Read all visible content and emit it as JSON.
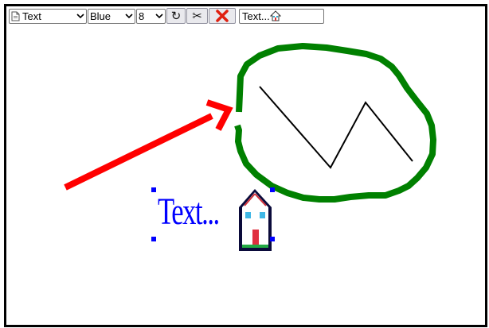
{
  "toolbar": {
    "tool_select": {
      "value": "Text",
      "icon": "document-icon"
    },
    "color_select": {
      "value": "Blue"
    },
    "size_select": {
      "value": "8"
    },
    "undo_glyph": "↻",
    "cut_glyph": "✂",
    "delete_glyph": "✖",
    "text_input_value": "Text...",
    "text_input_icon": "house-icon"
  },
  "canvas": {
    "text_object": "Text...",
    "text_color": "#0000ff",
    "arrow_color": "#ff0000",
    "ellipse_color": "#008000",
    "zigzag_color": "#000000"
  }
}
